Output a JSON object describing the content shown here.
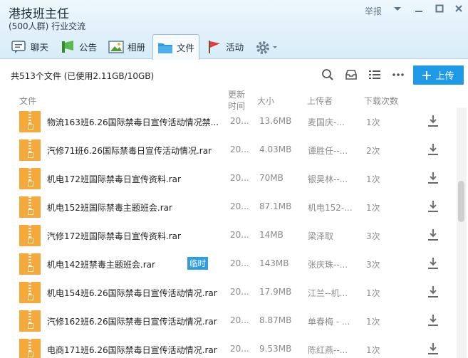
{
  "header": {
    "group_name": "港技班主任",
    "group_info": "(500人群) 行业交流",
    "report_label": "举报"
  },
  "tabs": [
    {
      "label": "聊天"
    },
    {
      "label": "公告"
    },
    {
      "label": "相册"
    },
    {
      "label": "文件"
    },
    {
      "label": "活动"
    }
  ],
  "toolbar": {
    "stats": "共513个文件 (已使用2.11GB/10GB)",
    "upload_label": "上传"
  },
  "columns": {
    "file": "文件",
    "updated_line1": "更新",
    "updated_line2": "时间",
    "size": "大小",
    "uploader": "上传者",
    "downloads": "下载次数"
  },
  "files": [
    {
      "name": "物流163班6.26国际禁毒日宣传活动情况禁...",
      "time": "20...",
      "size": "13.6MB",
      "uploader": "麦国庆-...",
      "downloads": "1次"
    },
    {
      "name": "汽修71班6.26国际禁毒日宣传活动情况.rar",
      "time": "20...",
      "size": "4.03MB",
      "uploader": "谭胜任--...",
      "downloads": "2次"
    },
    {
      "name": "机电172班国际禁毒日宣传资料.rar",
      "time": "20...",
      "size": "70MB",
      "uploader": "银昊林--...",
      "downloads": "1次"
    },
    {
      "name": "机电152班国际禁毒主题班会.rar",
      "time": "20...",
      "size": "87.1MB",
      "uploader": "机电152-...",
      "downloads": "1次"
    },
    {
      "name": "汽修172班国际禁毒日宣传资料.rar",
      "time": "20...",
      "size": "14MB",
      "uploader": "梁泽取",
      "downloads": "3次"
    },
    {
      "name": "机电142班禁毒主题班会.rar",
      "time": "20...",
      "size": "143MB",
      "uploader": "张庆珠--...",
      "downloads": "3次",
      "badge": "临时"
    },
    {
      "name": "机电154班6.26国际禁毒日宣传活动情况.rar",
      "time": "20...",
      "size": "17.9MB",
      "uploader": "江兰--机...",
      "downloads": "1次"
    },
    {
      "name": "汽修162班6.26国际禁毒日宣传活动情况.rar",
      "time": "20...",
      "size": "8.87MB",
      "uploader": "单春梅 - ...",
      "downloads": "1次"
    },
    {
      "name": "电商171班6.26国际禁毒日宣传活动情况.rar",
      "time": "20...",
      "size": "9.53MB",
      "uploader": "陈红燕--...",
      "downloads": "1次"
    }
  ],
  "colors": {
    "accent": "#1e9ae8",
    "file_icon": "#f5a93a",
    "header_bg": "#d7ecf9"
  }
}
